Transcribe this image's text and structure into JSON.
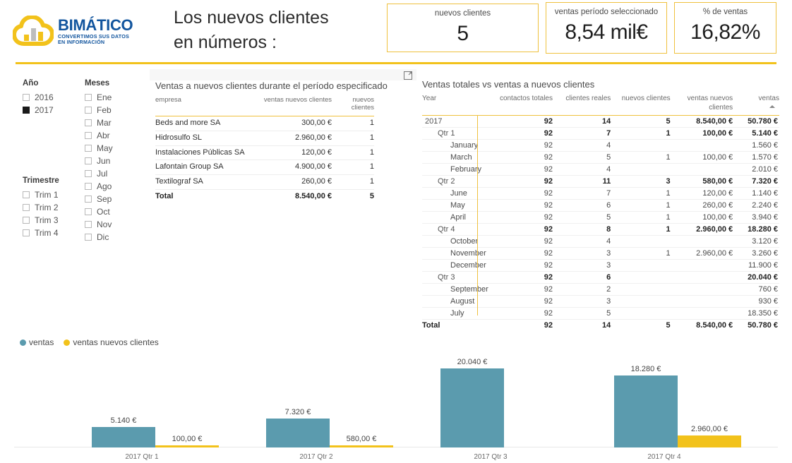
{
  "header": {
    "logo": {
      "mark": "cloud-bar-chart-logo",
      "title": "BIMÁTICO",
      "tagline_line1": "CONVERTIMOS SUS DATOS",
      "tagline_line2": "EN INFORMACIÓN",
      "brand_blue": "#12559E",
      "brand_yellow": "#F2C21B"
    },
    "title_line1": "Los nuevos clientes",
    "title_line2": "en números :",
    "kpis": [
      {
        "label": "nuevos clientes",
        "value": "5"
      },
      {
        "label": "ventas período seleccionado",
        "value": "8,54 mil€"
      },
      {
        "label": "% de ventas",
        "value": "16,82%"
      }
    ]
  },
  "slicers": {
    "anio": {
      "title": "Año",
      "items": [
        {
          "label": "2016",
          "checked": false
        },
        {
          "label": "2017",
          "checked": true
        }
      ]
    },
    "trimestre": {
      "title": "Trimestre",
      "items": [
        {
          "label": "Trim 1",
          "checked": false
        },
        {
          "label": "Trim 2",
          "checked": false
        },
        {
          "label": "Trim 3",
          "checked": false
        },
        {
          "label": "Trim 4",
          "checked": false
        }
      ]
    },
    "meses": {
      "title": "Meses",
      "items": [
        {
          "label": "Ene",
          "checked": false
        },
        {
          "label": "Feb",
          "checked": false
        },
        {
          "label": "Mar",
          "checked": false
        },
        {
          "label": "Abr",
          "checked": false
        },
        {
          "label": "May",
          "checked": false
        },
        {
          "label": "Jun",
          "checked": false
        },
        {
          "label": "Jul",
          "checked": false
        },
        {
          "label": "Ago",
          "checked": false
        },
        {
          "label": "Sep",
          "checked": false
        },
        {
          "label": "Oct",
          "checked": false
        },
        {
          "label": "Nov",
          "checked": false
        },
        {
          "label": "Dic",
          "checked": false
        }
      ]
    }
  },
  "table_new_clients": {
    "title": "Ventas a nuevos clientes durante el período especificado",
    "focus_icon": "focus-mode-icon",
    "columns": [
      "empresa",
      "ventas nuevos clientes",
      "nuevos clientes"
    ],
    "rows": [
      {
        "empresa": "Beds and more SA",
        "ventas": "300,00 €",
        "clientes": "1"
      },
      {
        "empresa": "Hidrosulfo SL",
        "ventas": "2.960,00 €",
        "clientes": "1"
      },
      {
        "empresa": "Instalaciones Públicas SA",
        "ventas": "120,00 €",
        "clientes": "1"
      },
      {
        "empresa": "Lafontain Group SA",
        "ventas": "4.900,00 €",
        "clientes": "1"
      },
      {
        "empresa": "Textilograf SA",
        "ventas": "260,00 €",
        "clientes": "1"
      }
    ],
    "total": {
      "empresa": "Total",
      "ventas": "8.540,00 €",
      "clientes": "5"
    }
  },
  "matrix": {
    "title": "Ventas totales vs ventas a nuevos clientes",
    "columns": [
      "Year",
      "contactos totales",
      "clientes reales",
      "nuevos clientes",
      "ventas nuevos clientes",
      "ventas"
    ],
    "sort_column": "ventas",
    "sort_direction": "asc",
    "rows": [
      {
        "level": 0,
        "label": "2017",
        "contactos": "92",
        "reales": "14",
        "nuevos": "5",
        "ventas_nuevos": "8.540,00 €",
        "ventas": "50.780 €"
      },
      {
        "level": 1,
        "label": "Qtr 1",
        "contactos": "92",
        "reales": "7",
        "nuevos": "1",
        "ventas_nuevos": "100,00 €",
        "ventas": "5.140 €"
      },
      {
        "level": 2,
        "label": "January",
        "contactos": "92",
        "reales": "4",
        "nuevos": "",
        "ventas_nuevos": "",
        "ventas": "1.560 €"
      },
      {
        "level": 2,
        "label": "March",
        "contactos": "92",
        "reales": "5",
        "nuevos": "1",
        "ventas_nuevos": "100,00 €",
        "ventas": "1.570 €"
      },
      {
        "level": 2,
        "label": "February",
        "contactos": "92",
        "reales": "4",
        "nuevos": "",
        "ventas_nuevos": "",
        "ventas": "2.010 €"
      },
      {
        "level": 1,
        "label": "Qtr 2",
        "contactos": "92",
        "reales": "11",
        "nuevos": "3",
        "ventas_nuevos": "580,00 €",
        "ventas": "7.320 €"
      },
      {
        "level": 2,
        "label": "June",
        "contactos": "92",
        "reales": "7",
        "nuevos": "1",
        "ventas_nuevos": "120,00 €",
        "ventas": "1.140 €"
      },
      {
        "level": 2,
        "label": "May",
        "contactos": "92",
        "reales": "6",
        "nuevos": "1",
        "ventas_nuevos": "260,00 €",
        "ventas": "2.240 €"
      },
      {
        "level": 2,
        "label": "April",
        "contactos": "92",
        "reales": "5",
        "nuevos": "1",
        "ventas_nuevos": "100,00 €",
        "ventas": "3.940 €"
      },
      {
        "level": 1,
        "label": "Qtr 4",
        "contactos": "92",
        "reales": "8",
        "nuevos": "1",
        "ventas_nuevos": "2.960,00 €",
        "ventas": "18.280 €"
      },
      {
        "level": 2,
        "label": "October",
        "contactos": "92",
        "reales": "4",
        "nuevos": "",
        "ventas_nuevos": "",
        "ventas": "3.120 €"
      },
      {
        "level": 2,
        "label": "November",
        "contactos": "92",
        "reales": "3",
        "nuevos": "1",
        "ventas_nuevos": "2.960,00 €",
        "ventas": "3.260 €"
      },
      {
        "level": 2,
        "label": "December",
        "contactos": "92",
        "reales": "3",
        "nuevos": "",
        "ventas_nuevos": "",
        "ventas": "11.900 €"
      },
      {
        "level": 1,
        "label": "Qtr 3",
        "contactos": "92",
        "reales": "6",
        "nuevos": "",
        "ventas_nuevos": "",
        "ventas": "20.040 €"
      },
      {
        "level": 2,
        "label": "September",
        "contactos": "92",
        "reales": "2",
        "nuevos": "",
        "ventas_nuevos": "",
        "ventas": "760 €"
      },
      {
        "level": 2,
        "label": "August",
        "contactos": "92",
        "reales": "3",
        "nuevos": "",
        "ventas_nuevos": "",
        "ventas": "930 €"
      },
      {
        "level": 2,
        "label": "July",
        "contactos": "92",
        "reales": "5",
        "nuevos": "",
        "ventas_nuevos": "",
        "ventas": "18.350 €"
      }
    ],
    "total": {
      "label": "Total",
      "contactos": "92",
      "reales": "14",
      "nuevos": "5",
      "ventas_nuevos": "8.540,00 €",
      "ventas": "50.780 €"
    }
  },
  "legend": [
    {
      "label": "ventas",
      "color": "#5B9BAE"
    },
    {
      "label": "ventas nuevos clientes",
      "color": "#F2C21B"
    }
  ],
  "chart_data": {
    "type": "bar",
    "title": "",
    "xlabel": "",
    "ylabel": "",
    "categories": [
      "2017 Qtr 1",
      "2017 Qtr 2",
      "2017 Qtr 3",
      "2017 Qtr 4"
    ],
    "series": [
      {
        "name": "ventas",
        "color": "#5B9BAE",
        "values": [
          5140,
          7320,
          20040,
          18280
        ],
        "labels": [
          "5.140 €",
          "7.320 €",
          "20.040 €",
          "18.280 €"
        ]
      },
      {
        "name": "ventas nuevos clientes",
        "color": "#F2C21B",
        "values": [
          100,
          580,
          0,
          2960
        ],
        "labels": [
          "100,00 €",
          "580,00 €",
          "",
          "2.960,00 €"
        ]
      }
    ],
    "ylim": [
      0,
      20040
    ],
    "grid": false,
    "legend_position": "top-left"
  }
}
